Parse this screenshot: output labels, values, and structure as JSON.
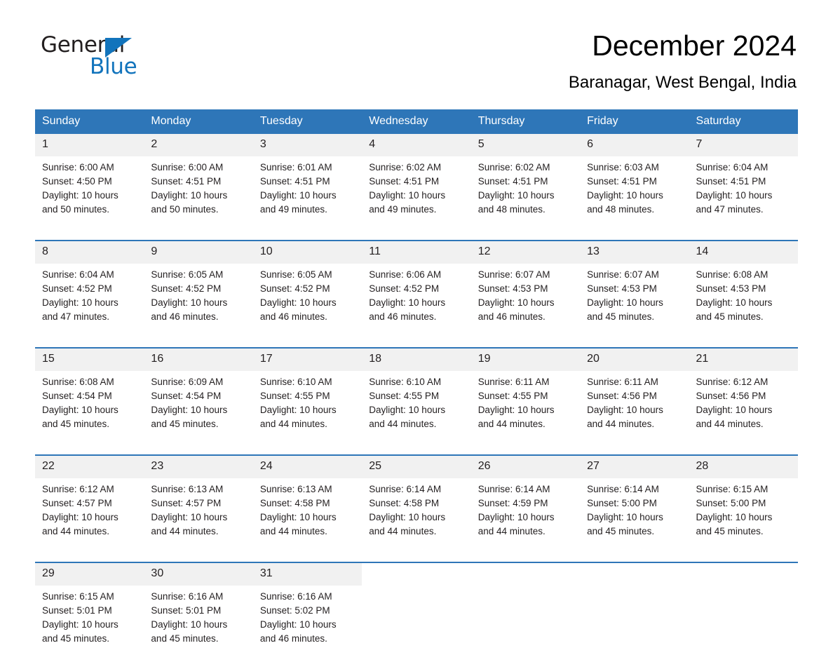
{
  "brand": {
    "name_part1": "General",
    "name_part2": "Blue"
  },
  "header": {
    "title": "December 2024",
    "subtitle": "Baranagar, West Bengal, India"
  },
  "colors": {
    "accent_blue": "#2e76b8",
    "logo_blue": "#1274bc",
    "date_band": "#f1f1f1"
  },
  "weekdays": [
    "Sunday",
    "Monday",
    "Tuesday",
    "Wednesday",
    "Thursday",
    "Friday",
    "Saturday"
  ],
  "weeks": [
    [
      {
        "date": "1",
        "sunrise": "Sunrise: 6:00 AM",
        "sunset": "Sunset: 4:50 PM",
        "daylight_1": "Daylight: 10 hours",
        "daylight_2": "and 50 minutes."
      },
      {
        "date": "2",
        "sunrise": "Sunrise: 6:00 AM",
        "sunset": "Sunset: 4:51 PM",
        "daylight_1": "Daylight: 10 hours",
        "daylight_2": "and 50 minutes."
      },
      {
        "date": "3",
        "sunrise": "Sunrise: 6:01 AM",
        "sunset": "Sunset: 4:51 PM",
        "daylight_1": "Daylight: 10 hours",
        "daylight_2": "and 49 minutes."
      },
      {
        "date": "4",
        "sunrise": "Sunrise: 6:02 AM",
        "sunset": "Sunset: 4:51 PM",
        "daylight_1": "Daylight: 10 hours",
        "daylight_2": "and 49 minutes."
      },
      {
        "date": "5",
        "sunrise": "Sunrise: 6:02 AM",
        "sunset": "Sunset: 4:51 PM",
        "daylight_1": "Daylight: 10 hours",
        "daylight_2": "and 48 minutes."
      },
      {
        "date": "6",
        "sunrise": "Sunrise: 6:03 AM",
        "sunset": "Sunset: 4:51 PM",
        "daylight_1": "Daylight: 10 hours",
        "daylight_2": "and 48 minutes."
      },
      {
        "date": "7",
        "sunrise": "Sunrise: 6:04 AM",
        "sunset": "Sunset: 4:51 PM",
        "daylight_1": "Daylight: 10 hours",
        "daylight_2": "and 47 minutes."
      }
    ],
    [
      {
        "date": "8",
        "sunrise": "Sunrise: 6:04 AM",
        "sunset": "Sunset: 4:52 PM",
        "daylight_1": "Daylight: 10 hours",
        "daylight_2": "and 47 minutes."
      },
      {
        "date": "9",
        "sunrise": "Sunrise: 6:05 AM",
        "sunset": "Sunset: 4:52 PM",
        "daylight_1": "Daylight: 10 hours",
        "daylight_2": "and 46 minutes."
      },
      {
        "date": "10",
        "sunrise": "Sunrise: 6:05 AM",
        "sunset": "Sunset: 4:52 PM",
        "daylight_1": "Daylight: 10 hours",
        "daylight_2": "and 46 minutes."
      },
      {
        "date": "11",
        "sunrise": "Sunrise: 6:06 AM",
        "sunset": "Sunset: 4:52 PM",
        "daylight_1": "Daylight: 10 hours",
        "daylight_2": "and 46 minutes."
      },
      {
        "date": "12",
        "sunrise": "Sunrise: 6:07 AM",
        "sunset": "Sunset: 4:53 PM",
        "daylight_1": "Daylight: 10 hours",
        "daylight_2": "and 46 minutes."
      },
      {
        "date": "13",
        "sunrise": "Sunrise: 6:07 AM",
        "sunset": "Sunset: 4:53 PM",
        "daylight_1": "Daylight: 10 hours",
        "daylight_2": "and 45 minutes."
      },
      {
        "date": "14",
        "sunrise": "Sunrise: 6:08 AM",
        "sunset": "Sunset: 4:53 PM",
        "daylight_1": "Daylight: 10 hours",
        "daylight_2": "and 45 minutes."
      }
    ],
    [
      {
        "date": "15",
        "sunrise": "Sunrise: 6:08 AM",
        "sunset": "Sunset: 4:54 PM",
        "daylight_1": "Daylight: 10 hours",
        "daylight_2": "and 45 minutes."
      },
      {
        "date": "16",
        "sunrise": "Sunrise: 6:09 AM",
        "sunset": "Sunset: 4:54 PM",
        "daylight_1": "Daylight: 10 hours",
        "daylight_2": "and 45 minutes."
      },
      {
        "date": "17",
        "sunrise": "Sunrise: 6:10 AM",
        "sunset": "Sunset: 4:55 PM",
        "daylight_1": "Daylight: 10 hours",
        "daylight_2": "and 44 minutes."
      },
      {
        "date": "18",
        "sunrise": "Sunrise: 6:10 AM",
        "sunset": "Sunset: 4:55 PM",
        "daylight_1": "Daylight: 10 hours",
        "daylight_2": "and 44 minutes."
      },
      {
        "date": "19",
        "sunrise": "Sunrise: 6:11 AM",
        "sunset": "Sunset: 4:55 PM",
        "daylight_1": "Daylight: 10 hours",
        "daylight_2": "and 44 minutes."
      },
      {
        "date": "20",
        "sunrise": "Sunrise: 6:11 AM",
        "sunset": "Sunset: 4:56 PM",
        "daylight_1": "Daylight: 10 hours",
        "daylight_2": "and 44 minutes."
      },
      {
        "date": "21",
        "sunrise": "Sunrise: 6:12 AM",
        "sunset": "Sunset: 4:56 PM",
        "daylight_1": "Daylight: 10 hours",
        "daylight_2": "and 44 minutes."
      }
    ],
    [
      {
        "date": "22",
        "sunrise": "Sunrise: 6:12 AM",
        "sunset": "Sunset: 4:57 PM",
        "daylight_1": "Daylight: 10 hours",
        "daylight_2": "and 44 minutes."
      },
      {
        "date": "23",
        "sunrise": "Sunrise: 6:13 AM",
        "sunset": "Sunset: 4:57 PM",
        "daylight_1": "Daylight: 10 hours",
        "daylight_2": "and 44 minutes."
      },
      {
        "date": "24",
        "sunrise": "Sunrise: 6:13 AM",
        "sunset": "Sunset: 4:58 PM",
        "daylight_1": "Daylight: 10 hours",
        "daylight_2": "and 44 minutes."
      },
      {
        "date": "25",
        "sunrise": "Sunrise: 6:14 AM",
        "sunset": "Sunset: 4:58 PM",
        "daylight_1": "Daylight: 10 hours",
        "daylight_2": "and 44 minutes."
      },
      {
        "date": "26",
        "sunrise": "Sunrise: 6:14 AM",
        "sunset": "Sunset: 4:59 PM",
        "daylight_1": "Daylight: 10 hours",
        "daylight_2": "and 44 minutes."
      },
      {
        "date": "27",
        "sunrise": "Sunrise: 6:14 AM",
        "sunset": "Sunset: 5:00 PM",
        "daylight_1": "Daylight: 10 hours",
        "daylight_2": "and 45 minutes."
      },
      {
        "date": "28",
        "sunrise": "Sunrise: 6:15 AM",
        "sunset": "Sunset: 5:00 PM",
        "daylight_1": "Daylight: 10 hours",
        "daylight_2": "and 45 minutes."
      }
    ],
    [
      {
        "date": "29",
        "sunrise": "Sunrise: 6:15 AM",
        "sunset": "Sunset: 5:01 PM",
        "daylight_1": "Daylight: 10 hours",
        "daylight_2": "and 45 minutes."
      },
      {
        "date": "30",
        "sunrise": "Sunrise: 6:16 AM",
        "sunset": "Sunset: 5:01 PM",
        "daylight_1": "Daylight: 10 hours",
        "daylight_2": "and 45 minutes."
      },
      {
        "date": "31",
        "sunrise": "Sunrise: 6:16 AM",
        "sunset": "Sunset: 5:02 PM",
        "daylight_1": "Daylight: 10 hours",
        "daylight_2": "and 46 minutes."
      },
      null,
      null,
      null,
      null
    ]
  ]
}
